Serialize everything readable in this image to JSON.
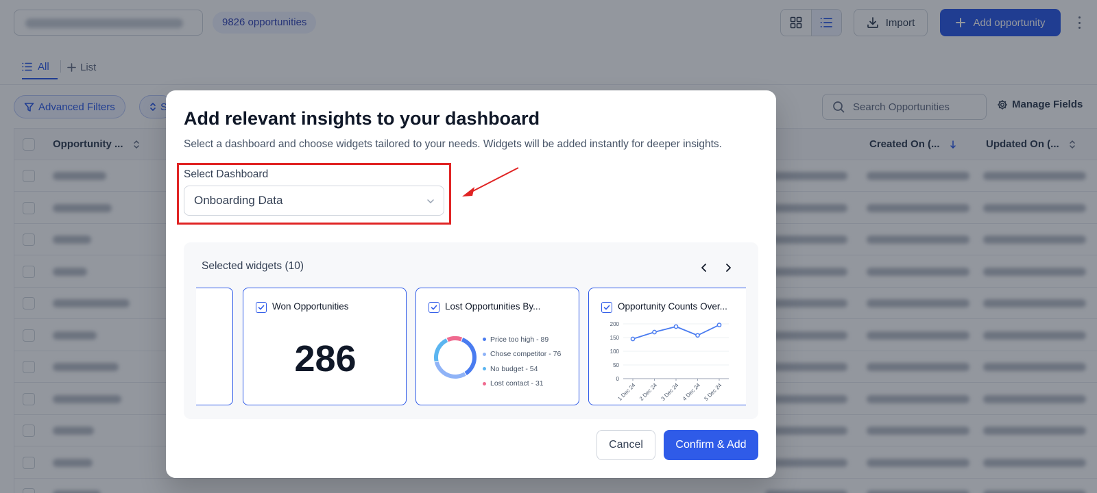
{
  "header": {
    "opportunity_count": "9826 opportunities",
    "import_label": "Import",
    "add_label": "Add opportunity"
  },
  "tabs": {
    "all_label": "All",
    "list_label": "List"
  },
  "toolbar": {
    "advanced_filters_label": "Advanced Filters",
    "sort_label": "S",
    "search_placeholder": "Search Opportunities",
    "manage_fields_label": "Manage Fields"
  },
  "table": {
    "columns": {
      "name": "Opportunity ...",
      "created": "Created On (...",
      "updated": "Updated On (..."
    },
    "row_count": 11
  },
  "modal": {
    "title": "Add relevant insights to your dashboard",
    "subtitle": "Select a dashboard and choose widgets tailored to your needs. Widgets will be added instantly for deeper insights.",
    "select_label": "Select Dashboard",
    "select_value": "Onboarding Data",
    "widgets_title": "Selected widgets (10)",
    "cancel_label": "Cancel",
    "confirm_label": "Confirm & Add",
    "highlight_color": "#e02424",
    "widgets": {
      "won": {
        "title": "Won Opportunities",
        "value": "286"
      },
      "lost": {
        "title": "Lost Opportunities By...",
        "legend": [
          {
            "label": "Price too high - 89",
            "color": "#4a7cf0"
          },
          {
            "label": "Chose competitor - 76",
            "color": "#8fb3f7"
          },
          {
            "label": "No budget - 54",
            "color": "#5bb5f0"
          },
          {
            "label": "Lost contact - 31",
            "color": "#ef6a8f"
          }
        ]
      },
      "counts": {
        "title": "Opportunity Counts Over..."
      }
    }
  },
  "chart_data": [
    {
      "type": "pie",
      "categories": [
        "Price too high",
        "Chose competitor",
        "No budget",
        "Lost contact"
      ],
      "values": [
        89,
        76,
        54,
        31
      ],
      "colors": [
        "#4a7cf0",
        "#8fb3f7",
        "#5bb5f0",
        "#ef6a8f"
      ]
    },
    {
      "type": "line",
      "categories": [
        "1 Dec 24",
        "2 Dec 24",
        "3 Dec 24",
        "4 Dec 24",
        "5 Dec 24"
      ],
      "values": [
        145,
        170,
        190,
        158,
        196
      ],
      "ylim": [
        0,
        200
      ],
      "yticks": [
        0,
        50,
        100,
        150,
        200
      ],
      "color": "#4a7cf0"
    }
  ]
}
